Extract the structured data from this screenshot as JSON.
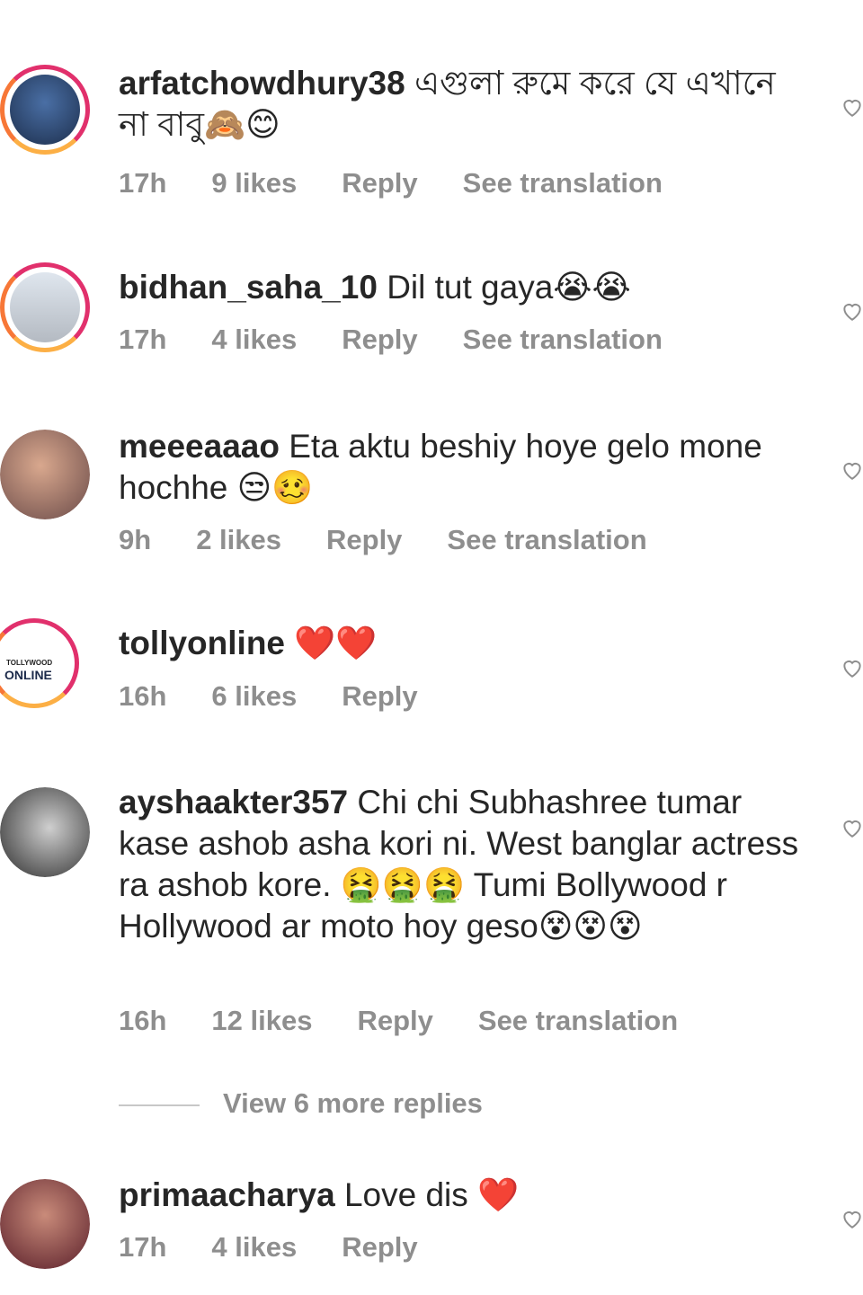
{
  "comments": [
    {
      "username": "arfatchowdhury38",
      "text": "এগুলা রুমে করে যে এখানে না বাবু🙈😊",
      "time": "17h",
      "likes": "9 likes",
      "reply": "Reply",
      "translate": "See translation"
    },
    {
      "username": "bidhan_saha_10",
      "text": "Dil tut gaya😭😭",
      "time": "17h",
      "likes": "4 likes",
      "reply": "Reply",
      "translate": "See translation"
    },
    {
      "username": "meeeaaao",
      "text": "Eta aktu beshiy hoye gelo mone hochhe 😒🥴",
      "time": "9h",
      "likes": "2 likes",
      "reply": "Reply",
      "translate": "See translation"
    },
    {
      "username": "tollyonline",
      "text": "❤️❤️",
      "time": "16h",
      "likes": "6 likes",
      "reply": "Reply",
      "logo_small": "TOLLYWOOD",
      "logo_big": "ONLINE"
    },
    {
      "username": "ayshaakter357",
      "text": "Chi chi Subhashree tumar kase ashob asha kori ni. West banglar actress ra ashob kore. 🤮🤮🤮 Tumi Bollywood r Hollywood ar moto hoy geso😵😵😵",
      "time": "16h",
      "likes": "12 likes",
      "reply": "Reply",
      "translate": "See translation"
    },
    {
      "username": "primaacharya",
      "text": "Love dis ❤️",
      "time": "17h",
      "likes": "4 likes",
      "reply": "Reply"
    }
  ],
  "view_more": "View 6 more replies",
  "icons": {
    "like": "heart-outline-icon"
  }
}
